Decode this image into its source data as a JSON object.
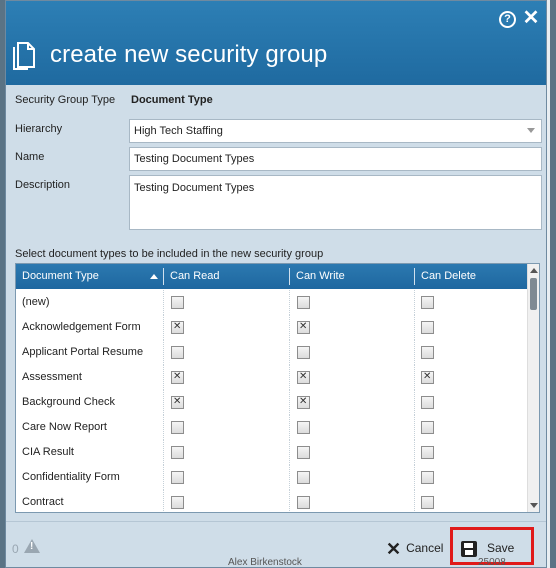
{
  "dialog": {
    "title": "create new security group",
    "help_icon": "question-circle-icon",
    "close_icon": "close-icon"
  },
  "form": {
    "security_group_type_label": "Security Group Type",
    "security_group_type_value": "Document Type",
    "hierarchy_label": "Hierarchy",
    "hierarchy_value": "High Tech Staffing",
    "name_label": "Name",
    "name_value": "Testing Document Types",
    "description_label": "Description",
    "description_value": "Testing Document Types",
    "grid_instruction": "Select document types to be included in the new security group"
  },
  "grid": {
    "columns": [
      "Document Type",
      "Can Read",
      "Can Write",
      "Can Delete"
    ],
    "rows": [
      {
        "name": "(new)",
        "read": false,
        "write": false,
        "delete": false
      },
      {
        "name": "Acknowledgement Form",
        "read": true,
        "write": true,
        "delete": false
      },
      {
        "name": "Applicant Portal Resume",
        "read": false,
        "write": false,
        "delete": false
      },
      {
        "name": "Assessment",
        "read": true,
        "write": true,
        "delete": true
      },
      {
        "name": "Background Check",
        "read": true,
        "write": true,
        "delete": false
      },
      {
        "name": "Care Now Report",
        "read": false,
        "write": false,
        "delete": false
      },
      {
        "name": "CIA Result",
        "read": false,
        "write": false,
        "delete": false
      },
      {
        "name": "Confidentiality Form",
        "read": false,
        "write": false,
        "delete": false
      },
      {
        "name": "Contract",
        "read": false,
        "write": false,
        "delete": false
      }
    ]
  },
  "footer": {
    "warning_count": "0",
    "cancel_label": "Cancel",
    "save_label": "Save"
  },
  "background": {
    "footer_text": "Alex Birkenstock",
    "footer_num": "25008"
  },
  "colors": {
    "title_bar": "#1f6aa0",
    "grid_header": "#2c79b0",
    "dialog_bg": "#cfdde8",
    "highlight": "#e01a1a"
  }
}
